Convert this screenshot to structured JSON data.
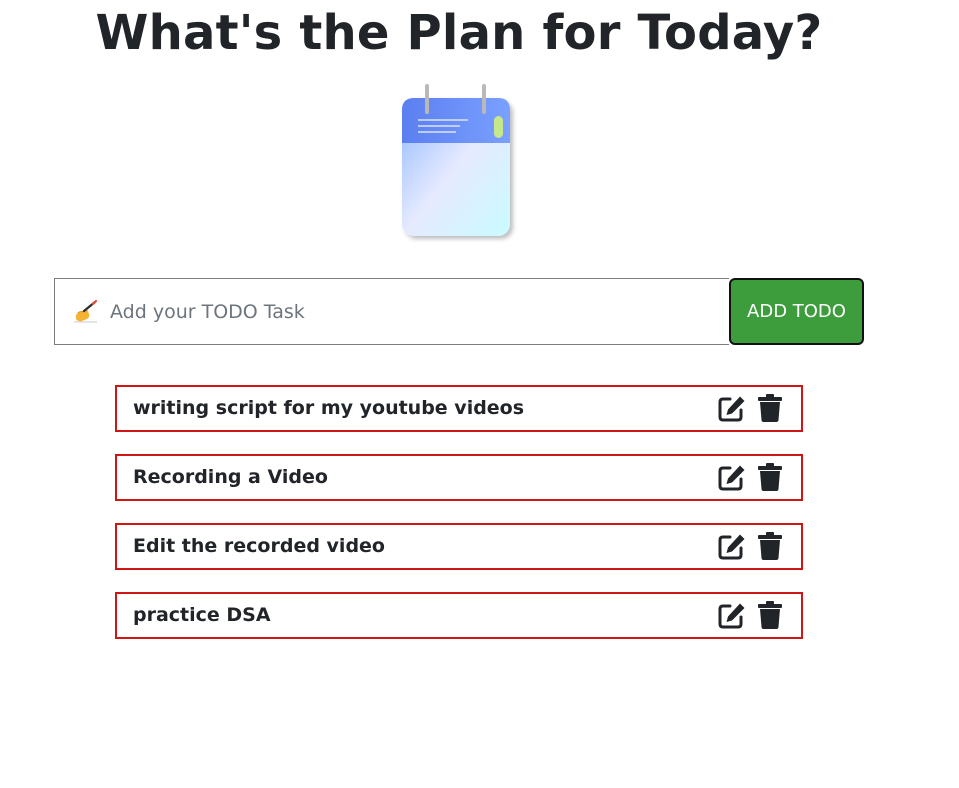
{
  "header": {
    "title": "What's the Plan for Today?"
  },
  "illustration": {
    "icon": "notepad-icon"
  },
  "todo_input": {
    "icon": "writing-hand-icon",
    "value": "",
    "placeholder": "Add your TODO Task"
  },
  "add_button": {
    "label": "ADD TODO",
    "color": "#3d9d3d"
  },
  "todos": [
    {
      "text": "writing script for my youtube videos"
    },
    {
      "text": "Recording a Video"
    },
    {
      "text": "Edit the recorded video"
    },
    {
      "text": "practice DSA"
    }
  ],
  "item_actions": {
    "edit_icon": "edit-icon",
    "delete_icon": "trash-icon"
  },
  "colors": {
    "item_border": "#d01515",
    "button_bg": "#3d9d3d",
    "text": "#212529"
  }
}
